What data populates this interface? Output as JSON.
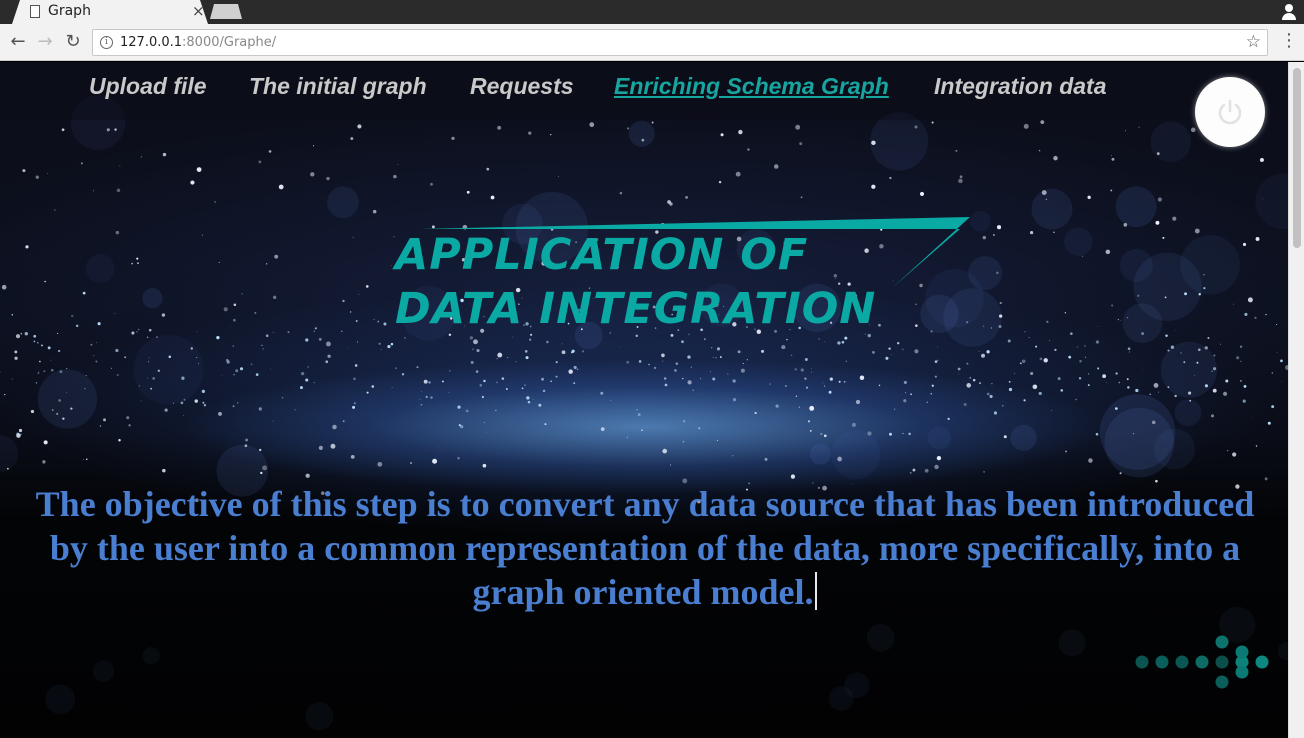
{
  "browser": {
    "tab_title": "Graph",
    "url_host": "127.0.0.1",
    "url_rest": ":8000/Graphe/",
    "icons": [
      "page-icon",
      "close-icon",
      "back-icon",
      "forward-icon",
      "reload-icon",
      "info-icon",
      "star-icon",
      "menu-icon",
      "profile-icon"
    ]
  },
  "nav": {
    "items": [
      {
        "label": "Upload file"
      },
      {
        "label": "The initial graph"
      },
      {
        "label": "Requests"
      },
      {
        "label": "Enriching Schema Graph"
      },
      {
        "label": "Integration data"
      }
    ],
    "active_index": 3,
    "active_color": "#17a5a0"
  },
  "logo": {
    "line1": "APPLICATION OF",
    "line2": "DATA INTEGRATION",
    "color": "#0aa9a3"
  },
  "description": "The objective of this step is to convert any data source that has been introduced by the user into a common representation of the data, more specifically, into a graph oriented model.",
  "description_color": "#4a7ed1",
  "power_icon": "power-icon"
}
